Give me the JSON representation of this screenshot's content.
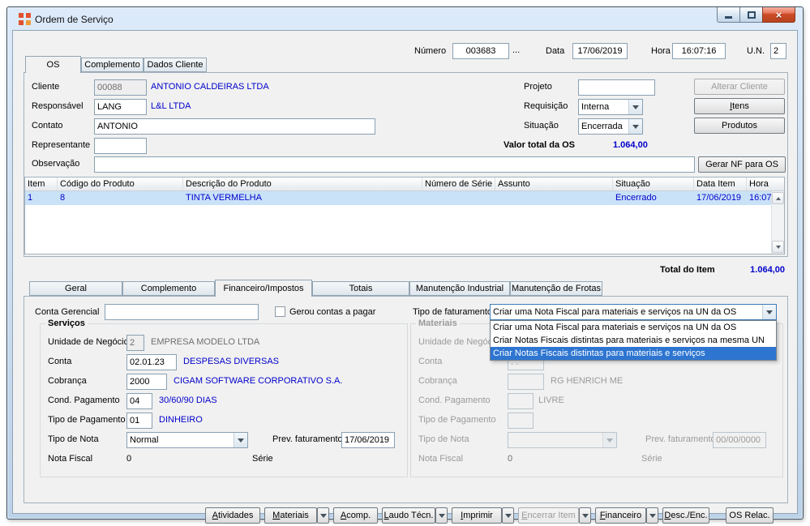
{
  "window": {
    "title": "Ordem de Serviço"
  },
  "icons": {
    "close_glyph": "×",
    "app": "orange-squares-logo",
    "minimize": "dash",
    "maximize": "square",
    "combo_arrow": "triangle-down",
    "scroll_up": "triangle-up",
    "scroll_down": "triangle-down"
  },
  "colors": {
    "link_blue": "#0000cc",
    "row_highlight": "#c9e2f8",
    "selection_blue": "#2e75d1"
  },
  "header": {
    "numero_label": "Número",
    "numero_value": "003683",
    "numero_more": "...",
    "data_label": "Data",
    "data_value": "17/06/2019",
    "hora_label": "Hora",
    "hora_value": "16:07:16",
    "un_label": "U.N.",
    "un_value": "2"
  },
  "main_tabs": [
    "OS",
    "Complemento",
    "Dados Cliente"
  ],
  "form": {
    "cliente_label": "Cliente",
    "cliente_code": "00088",
    "cliente_name": "ANTONIO CALDEIRAS LTDA",
    "responsavel_label": "Responsável",
    "responsavel_code": "LANG",
    "responsavel_name": "L&L LTDA",
    "contato_label": "Contato",
    "contato_value": "ANTONIO",
    "representante_label": "Representante",
    "representante_value": "",
    "observacao_label": "Observação",
    "observacao_value": "",
    "projeto_label": "Projeto",
    "projeto_value": "",
    "requisicao_label": "Requisição",
    "requisicao_value": "Interna",
    "situacao_label": "Situação",
    "situacao_value": "Encerrada",
    "valor_total_label": "Valor total da OS",
    "valor_total_value": "1.064,00",
    "btn_alterar_cliente": "Alterar Cliente",
    "btn_itens": "Itens",
    "btn_produtos": "Produtos",
    "btn_gerar_nf": "Gerar NF para OS"
  },
  "items_table": {
    "columns": [
      "Item",
      "Código do Produto",
      "Descrição do Produto",
      "Número de Série",
      "Assunto",
      "Situação",
      "Data Item",
      "Hora"
    ],
    "row": {
      "item": "1",
      "codigo": "8",
      "descricao": "TINTA VERMELHA",
      "numero_serie": "",
      "assunto": "",
      "situacao": "Encerrado",
      "data_item": "17/06/2019",
      "hora": "16:07"
    },
    "total_label": "Total do Item",
    "total_value": "1.064,00"
  },
  "detail_tabs": [
    "Geral",
    "Complemento",
    "Financeiro/Impostos",
    "Totais",
    "Manutenção Industrial",
    "Manutenção de Frotas"
  ],
  "financeiro": {
    "conta_gerencial_label": "Conta Gerencial",
    "conta_gerencial_value": "",
    "gerou_contas_label": "Gerou contas a pagar",
    "tipo_faturamento_label": "Tipo de faturamento",
    "tipo_faturamento_value": "Criar uma Nota Fiscal para materiais e serviços na UN da OS",
    "tipo_faturamento_options": [
      "Criar uma Nota Fiscal para materiais e serviços na UN da OS",
      "Criar Notas Fiscais distintas para materiais e serviços na mesma UN",
      "Criar Notas Fiscais distintas para materiais e serviços"
    ],
    "servicos": {
      "title": "Serviços",
      "un_label": "Unidade de Negócio",
      "un_code": "2",
      "un_name": "EMPRESA MODELO LTDA",
      "conta_label": "Conta",
      "conta_code": "02.01.23",
      "conta_name": "DESPESAS DIVERSAS",
      "cobranca_label": "Cobrança",
      "cobranca_code": "2000",
      "cobranca_name": "CIGAM SOFTWARE CORPORATIVO S.A.",
      "cond_label": "Cond. Pagamento",
      "cond_code": "04",
      "cond_name": "30/60/90 DIAS",
      "tipo_pag_label": "Tipo de Pagamento",
      "tipo_pag_code": "01",
      "tipo_pag_name": "DINHEIRO",
      "tipo_nota_label": "Tipo de Nota",
      "tipo_nota_value": "Normal",
      "prev_label": "Prev. faturamento",
      "prev_value": "17/06/2019",
      "nota_fiscal_label": "Nota Fiscal",
      "nota_fiscal_value": "0",
      "serie_label": "Série"
    },
    "materiais": {
      "title": "Materiais",
      "un_label": "Unidade de Negócio",
      "un_code": "",
      "conta_label": "Conta",
      "conta_code": ". .",
      "cobranca_label": "Cobrança",
      "cobranca_code": "",
      "cobranca_name": "RG HENRICH ME",
      "cond_label": "Cond. Pagamento",
      "cond_code": "",
      "cond_name": "LIVRE",
      "tipo_pag_label": "Tipo de Pagamento",
      "tipo_pag_code": "",
      "tipo_nota_label": "Tipo de Nota",
      "tipo_nota_value": "",
      "prev_label": "Prev. faturamento",
      "prev_value": "00/00/0000",
      "nota_fiscal_label": "Nota Fiscal",
      "nota_fiscal_value": "0",
      "serie_label": "Série"
    }
  },
  "bottom_buttons": [
    "Atividades",
    "Materiais",
    "Acomp.",
    "Laudo Técn.",
    "Imprimir",
    "Encerrar Item",
    "Financeiro",
    "Desc./Enc.",
    "OS Relac."
  ]
}
